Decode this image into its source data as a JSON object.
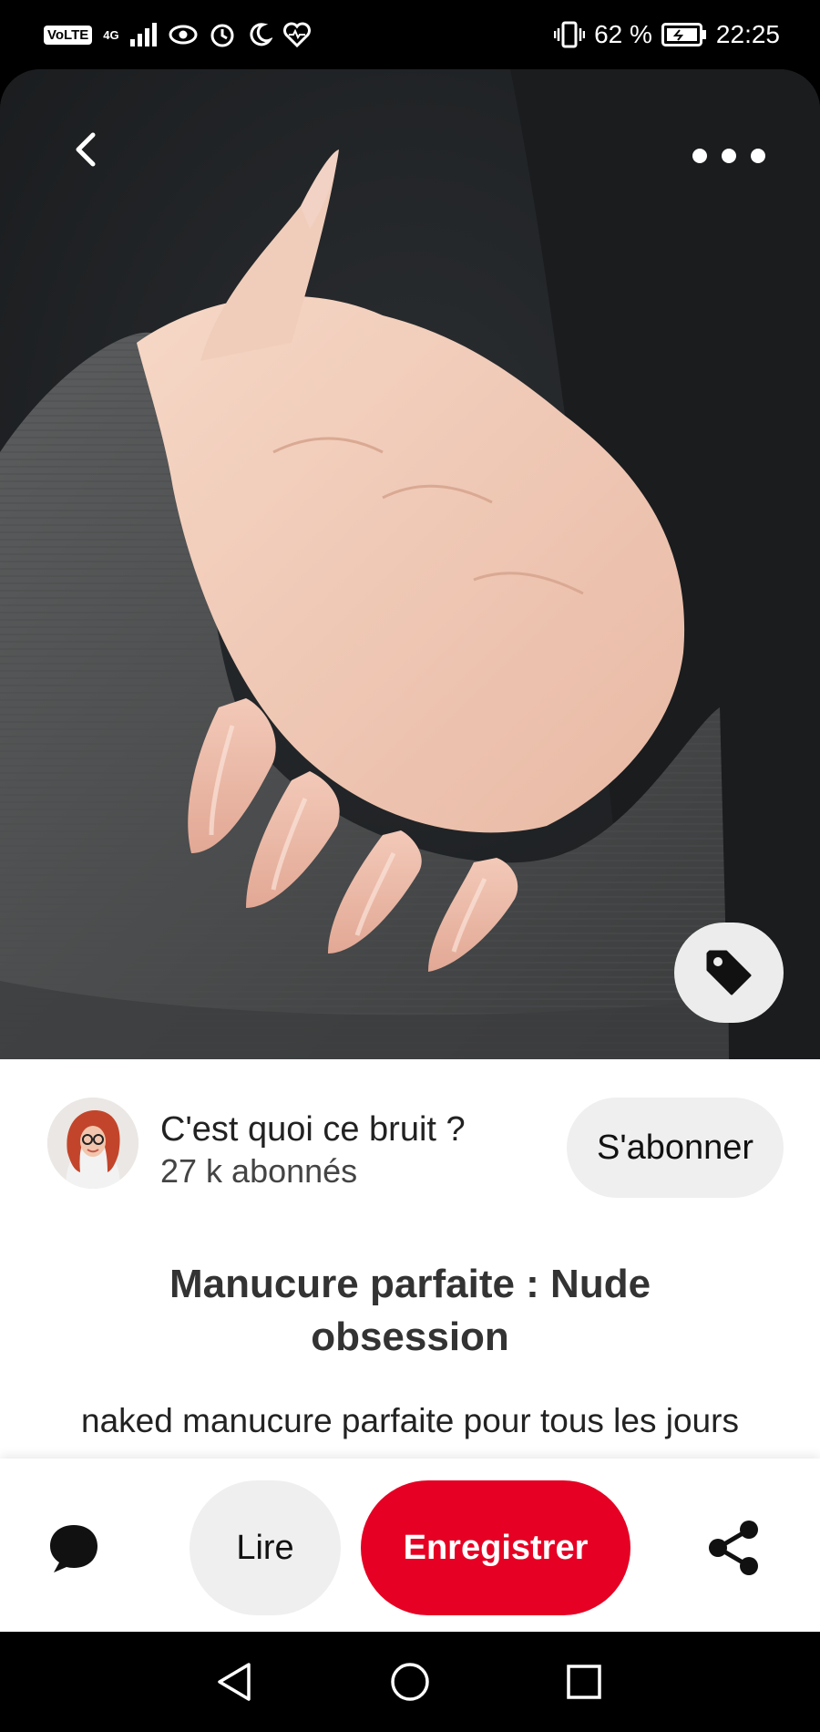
{
  "status_bar": {
    "volte": "VoLTE",
    "network": "4G",
    "battery_percent": "62 %",
    "time": "22:25",
    "icons": [
      "signal-icon",
      "eye-icon",
      "alarm-icon",
      "moon-icon",
      "heart-monitor-icon",
      "vibrate-icon",
      "battery-icon"
    ]
  },
  "pin": {
    "image_description_icon": "nail-photo",
    "creator": {
      "name": "C'est quoi ce bruit ?",
      "followers": "27 k abonnés",
      "subscribe_label": "S'abonner"
    },
    "title": "Manucure parfaite : Nude obsession",
    "description": "naked manucure parfaite pour tous les jours"
  },
  "actions": {
    "read_label": "Lire",
    "save_label": "Enregistrer"
  },
  "colors": {
    "accent": "#e60023",
    "secondary_button": "#efefef",
    "text": "#222222"
  }
}
